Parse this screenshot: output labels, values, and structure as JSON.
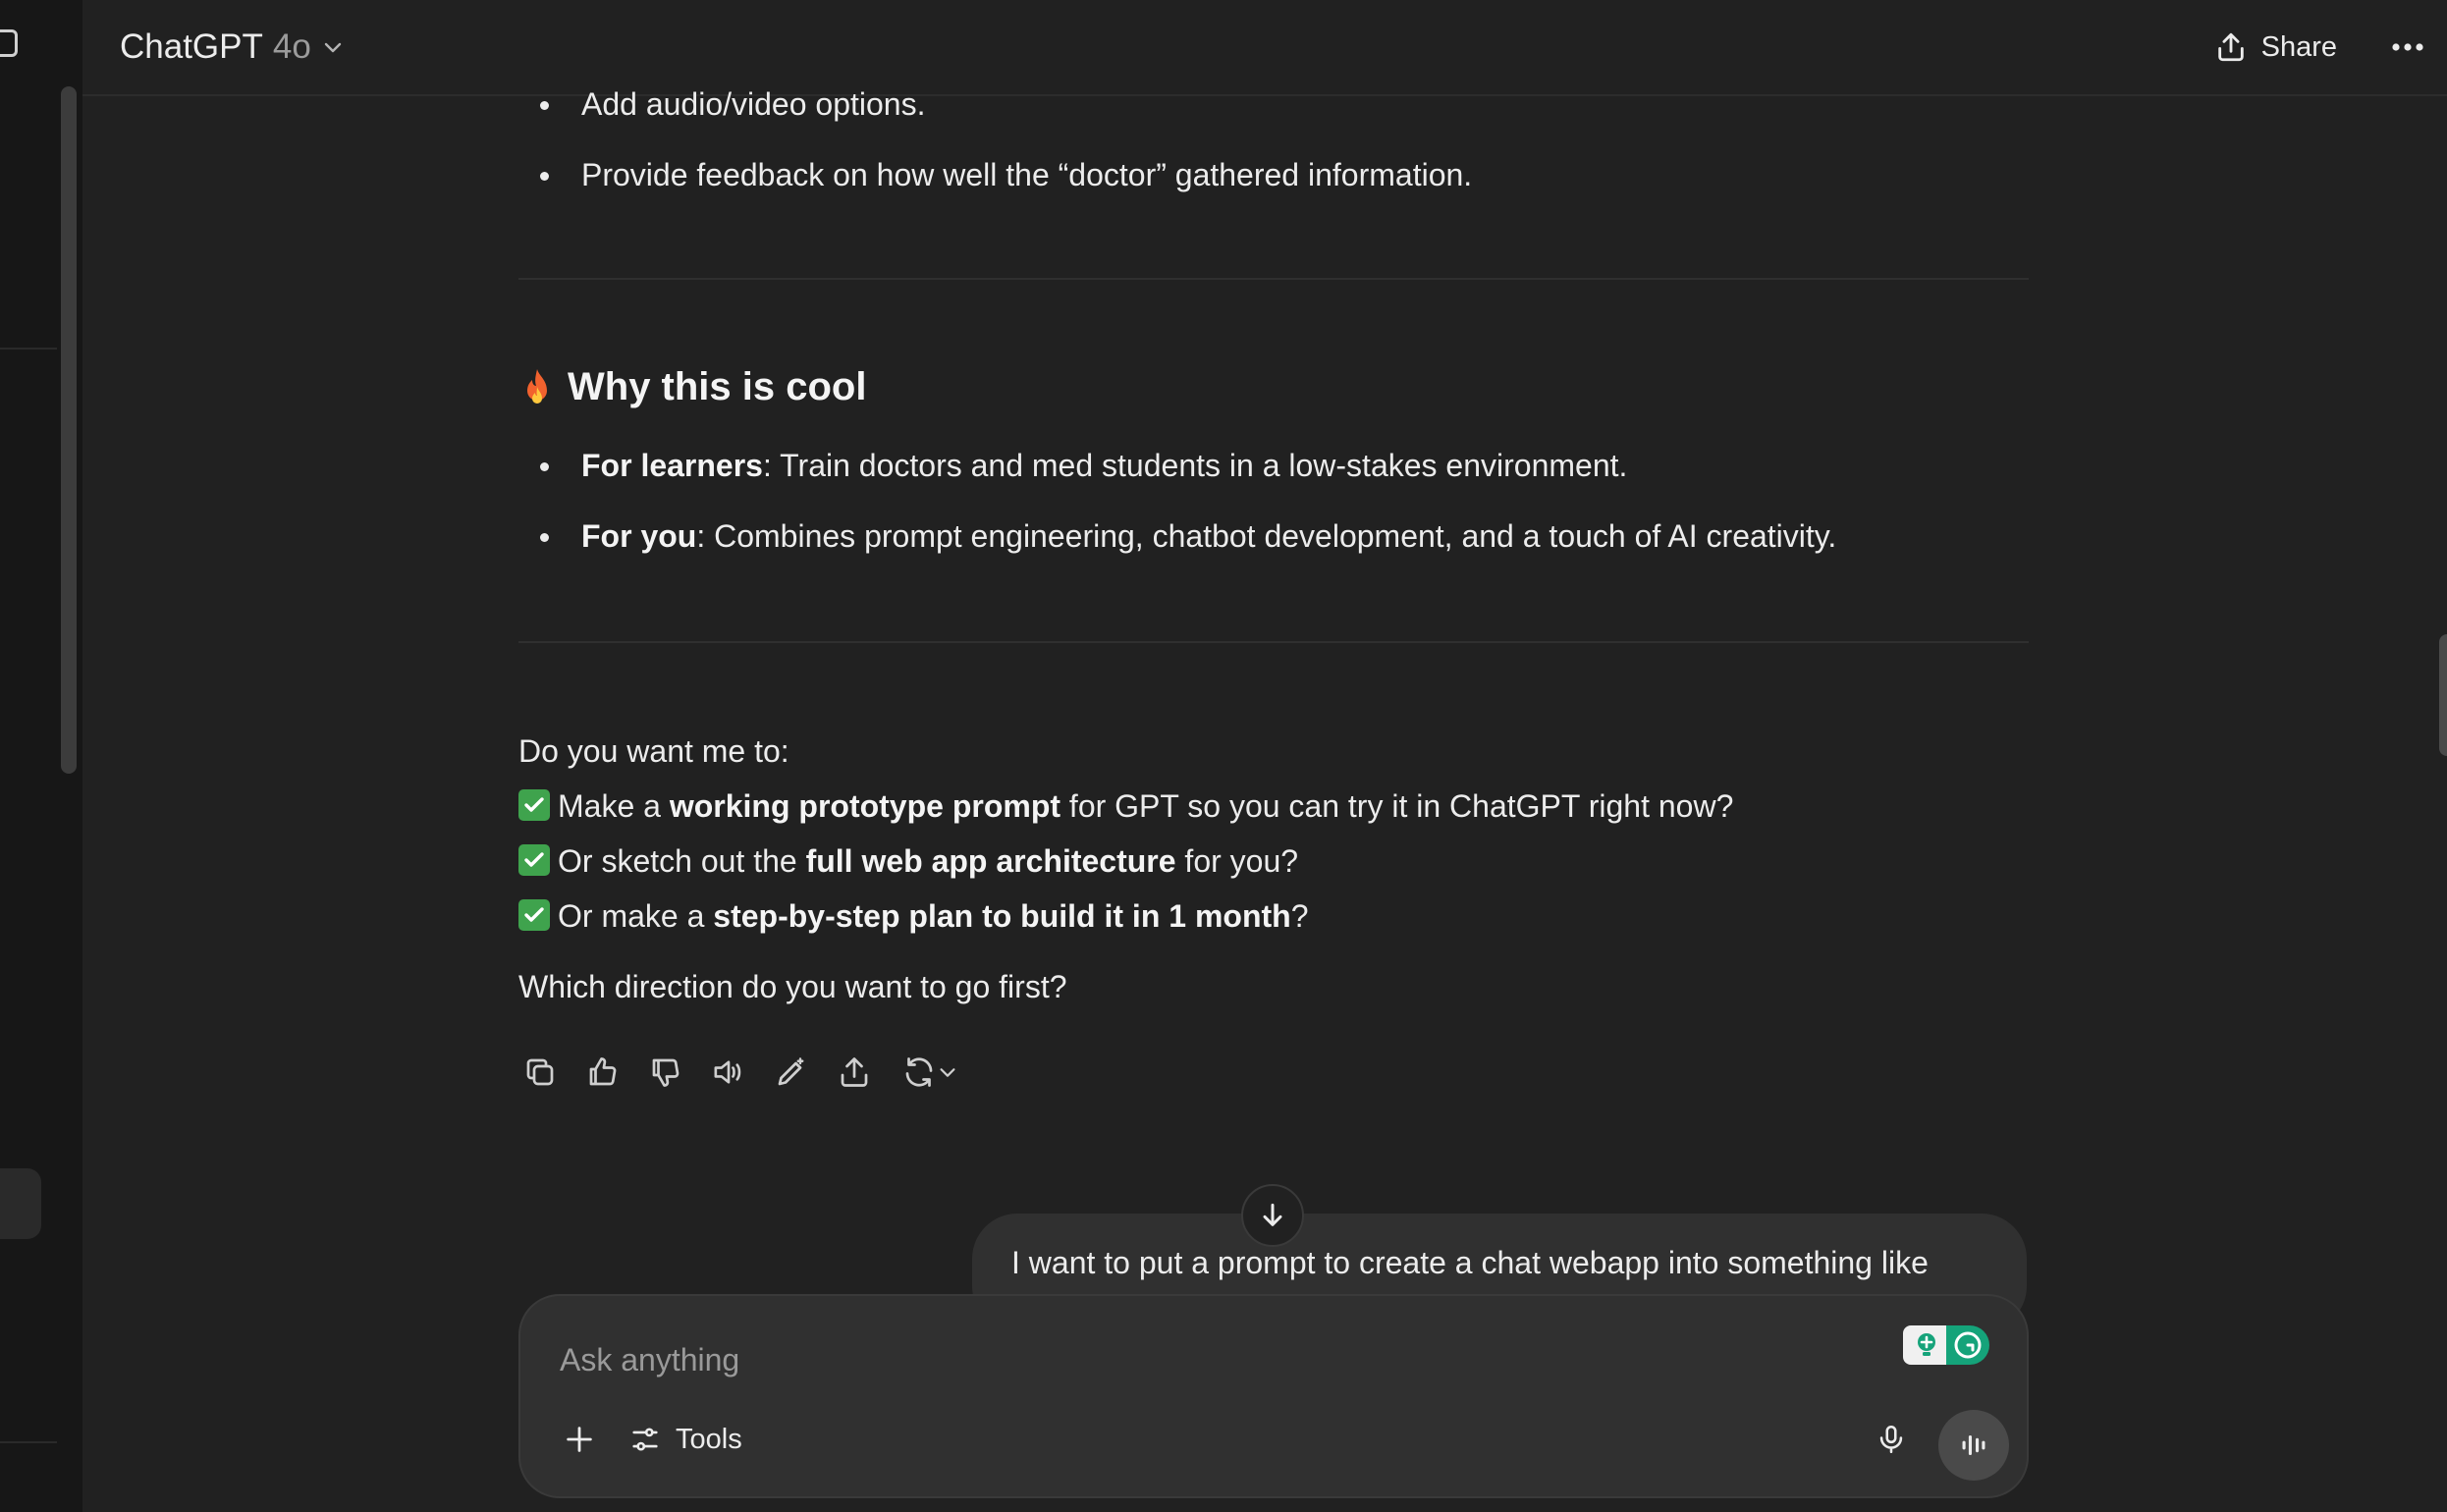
{
  "header": {
    "model_name": "ChatGPT",
    "model_version": "4o",
    "share_label": "Share"
  },
  "message": {
    "top_bullets": [
      "Add audio/video options.",
      "Provide feedback on how well the “doctor” gathered information."
    ],
    "heading_emoji": "fire",
    "heading": "Why this is cool",
    "cool_bullets": [
      {
        "bold": "For learners",
        "rest": ": Train doctors and med students in a low-stakes environment."
      },
      {
        "bold": "For you",
        "rest": ": Combines prompt engineering, chatbot development, and a touch of AI creativity."
      }
    ],
    "question_intro": "Do you want me to:",
    "options": [
      {
        "pre": "Make a ",
        "bold": "working prototype prompt",
        "post": " for GPT so you can try it in ChatGPT right now?"
      },
      {
        "pre": "Or sketch out the ",
        "bold": "full web app architecture",
        "post": " for you?"
      },
      {
        "pre": "Or make a ",
        "bold": "step-by-step plan to build it in 1 month",
        "post": "?"
      }
    ],
    "closing": "Which direction do you want to go first?"
  },
  "user_message": {
    "text": "I want to put a prompt to create a chat webapp into something like"
  },
  "composer": {
    "placeholder": "Ask anything",
    "tools_label": "Tools"
  },
  "colors": {
    "background": "#212121",
    "sidebar": "#171717",
    "composer": "#303030",
    "check_green": "#3fa34d",
    "grammarly_green": "#15a37a"
  }
}
